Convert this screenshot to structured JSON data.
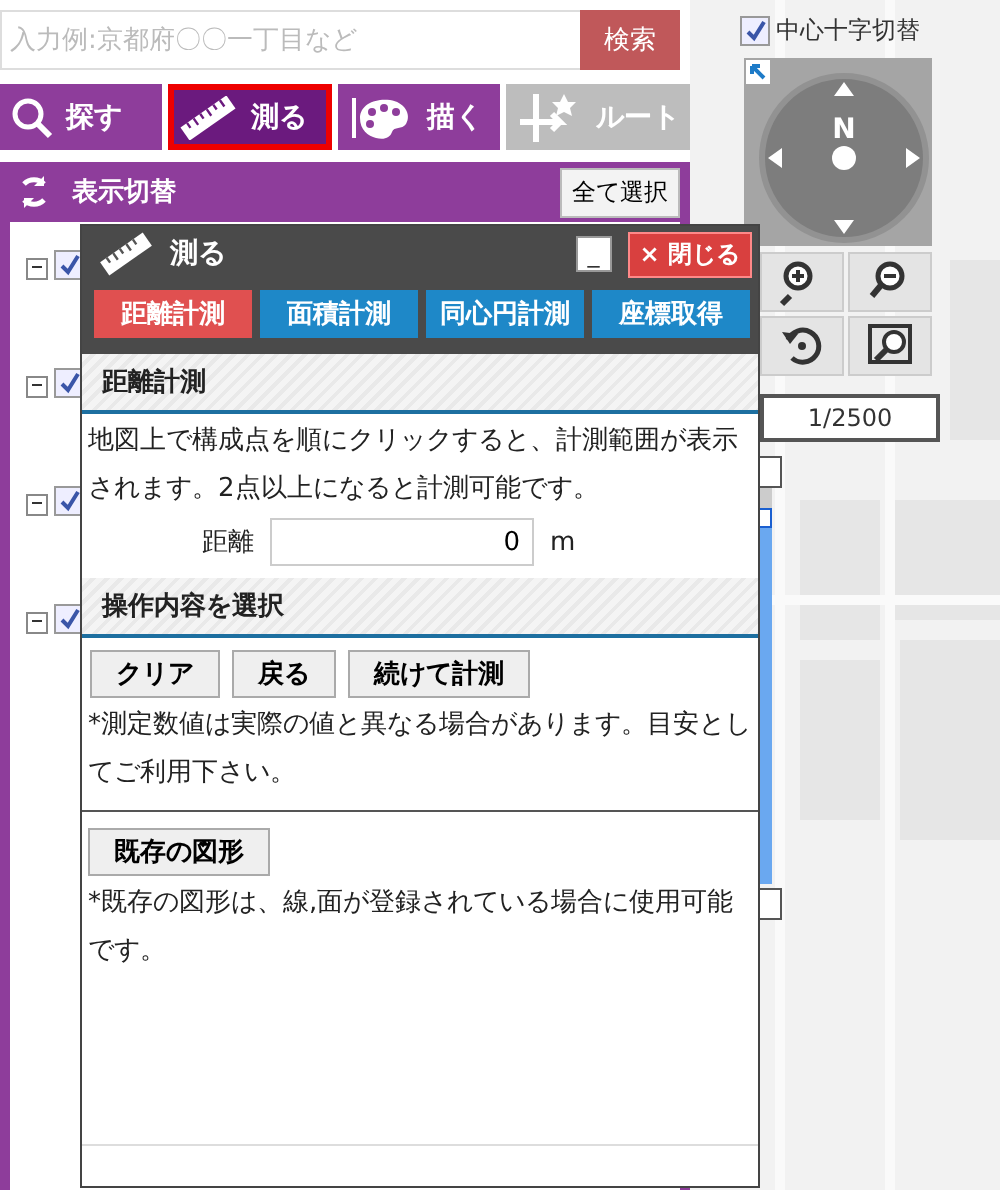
{
  "search": {
    "placeholder": "入力例:京都府〇〇一丁目など",
    "button": "検索"
  },
  "tabs": [
    {
      "kind": "search",
      "label": "探す",
      "selected": false,
      "disabled": false
    },
    {
      "kind": "measure",
      "label": "測る",
      "selected": true,
      "disabled": false
    },
    {
      "kind": "draw",
      "label": "描く",
      "selected": false,
      "disabled": false
    },
    {
      "kind": "route",
      "label": "ルート",
      "selected": false,
      "disabled": true
    }
  ],
  "layer_panel": {
    "title": "表示切替",
    "select_all": "全て選択",
    "layers": [
      {
        "expanded": true,
        "checked": true
      },
      {
        "expanded": true,
        "checked": true
      },
      {
        "expanded": true,
        "checked": true
      },
      {
        "expanded": true,
        "checked": true
      }
    ]
  },
  "map": {
    "kind": "picture",
    "crosshair": {
      "label": "中心十字切替",
      "checked": true
    },
    "compass": {
      "north": "N"
    },
    "scale": "1/2500",
    "zoom_slider": {
      "level": 0.92
    }
  },
  "dialog": {
    "title": "測る",
    "minimize": "_",
    "close": "× 閉じる",
    "tabs": [
      {
        "label": "距離計測",
        "selected": true
      },
      {
        "label": "面積計測",
        "selected": false
      },
      {
        "label": "同心円計測",
        "selected": false
      },
      {
        "label": "座標取得",
        "selected": false
      }
    ],
    "section_title": "距離計測",
    "instructions": "地図上で構成点を順にクリックすると、計測範囲が表示されます。2点以上になると計測可能です。",
    "distance": {
      "label": "距離",
      "value": "0",
      "unit": "m"
    },
    "operations_title": "操作内容を選択",
    "buttons": [
      "クリア",
      "戻る",
      "続けて計測"
    ],
    "note": "*測定数値は実際の値と異なる場合があります。目安としてご利用下さい。",
    "existing_button": "既存の図形",
    "existing_note": "*既存の図形は、線,面が登録されている場合に使用可能です。"
  }
}
